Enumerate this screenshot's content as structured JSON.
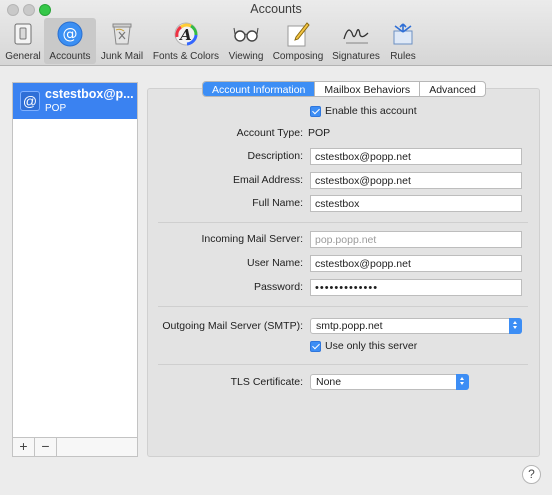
{
  "window": {
    "title": "Accounts"
  },
  "toolbar": {
    "items": [
      {
        "label": "General"
      },
      {
        "label": "Accounts"
      },
      {
        "label": "Junk Mail"
      },
      {
        "label": "Fonts & Colors"
      },
      {
        "label": "Viewing"
      },
      {
        "label": "Composing"
      },
      {
        "label": "Signatures"
      },
      {
        "label": "Rules"
      }
    ],
    "selected": "Accounts"
  },
  "sidebar": {
    "accounts": [
      {
        "name": "cstestbox@p...",
        "type": "POP"
      }
    ],
    "add_symbol": "+",
    "remove_symbol": "−"
  },
  "tabs": {
    "items": [
      {
        "label": "Account Information"
      },
      {
        "label": "Mailbox Behaviors"
      },
      {
        "label": "Advanced"
      }
    ],
    "active": "Account Information"
  },
  "form": {
    "enable_label": "Enable this account",
    "enable_checked": true,
    "account_type_label": "Account Type:",
    "account_type_value": "POP",
    "description_label": "Description:",
    "description_value": "cstestbox@popp.net",
    "email_label": "Email Address:",
    "email_value": "cstestbox@popp.net",
    "fullname_label": "Full Name:",
    "fullname_value": "cstestbox",
    "incoming_label": "Incoming Mail Server:",
    "incoming_placeholder": "pop.popp.net",
    "username_label": "User Name:",
    "username_value": "cstestbox@popp.net",
    "password_label": "Password:",
    "password_value": "•••••••••••••",
    "outgoing_label": "Outgoing Mail Server (SMTP):",
    "outgoing_value": "smtp.popp.net",
    "use_only_label": "Use only this server",
    "use_only_checked": true,
    "tls_label": "TLS Certificate:",
    "tls_value": "None"
  },
  "help_symbol": "?",
  "colors": {
    "accent": "#3d8ef5",
    "selection": "#3a82f1"
  }
}
